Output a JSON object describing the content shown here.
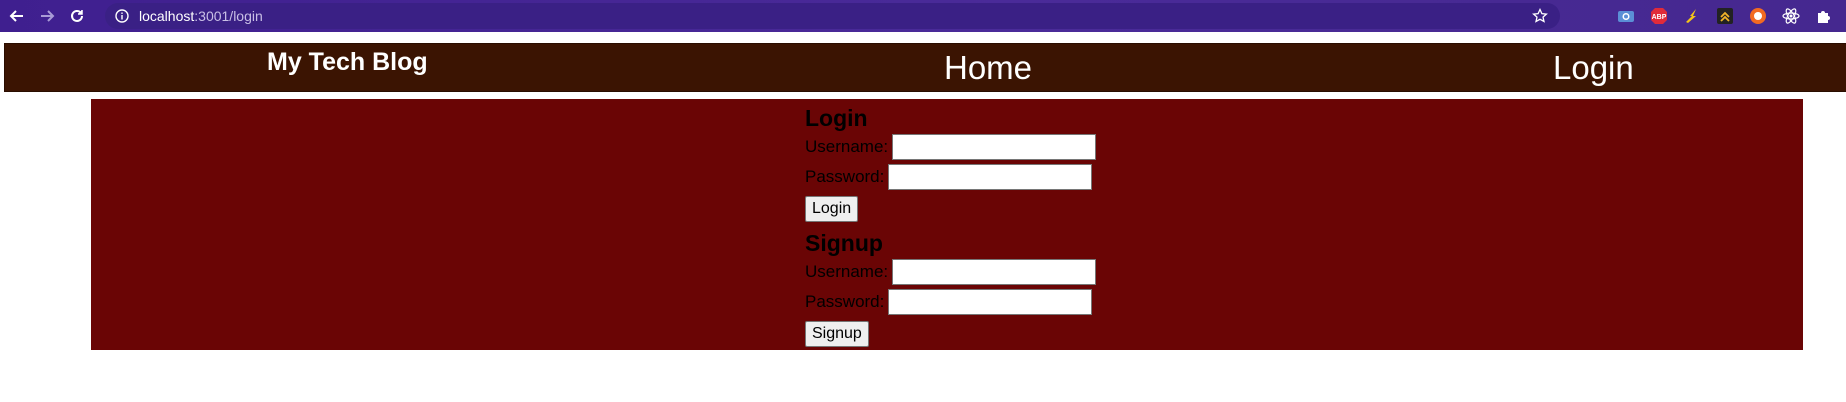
{
  "browser": {
    "url_host": "localhost",
    "url_rest": ":3001/login",
    "extensions": [
      "camera-icon",
      "adblock-icon",
      "lightning-icon",
      "chevrons-up-icon",
      "brave-icon",
      "react-icon",
      "puzzle-icon"
    ],
    "extension_labels": {
      "adblock": "ABP"
    }
  },
  "nav": {
    "brand": "My Tech Blog",
    "home": "Home",
    "login": "Login"
  },
  "login_form": {
    "title": "Login",
    "username_label": "Username:",
    "password_label": "Password:",
    "submit": "Login"
  },
  "signup_form": {
    "title": "Signup",
    "username_label": "Username:",
    "password_label": "Password:",
    "submit": "Signup"
  },
  "colors": {
    "nav_bg": "#3b1402",
    "panel_bg": "#6a0505",
    "chrome_bg": "#4a2b99"
  }
}
